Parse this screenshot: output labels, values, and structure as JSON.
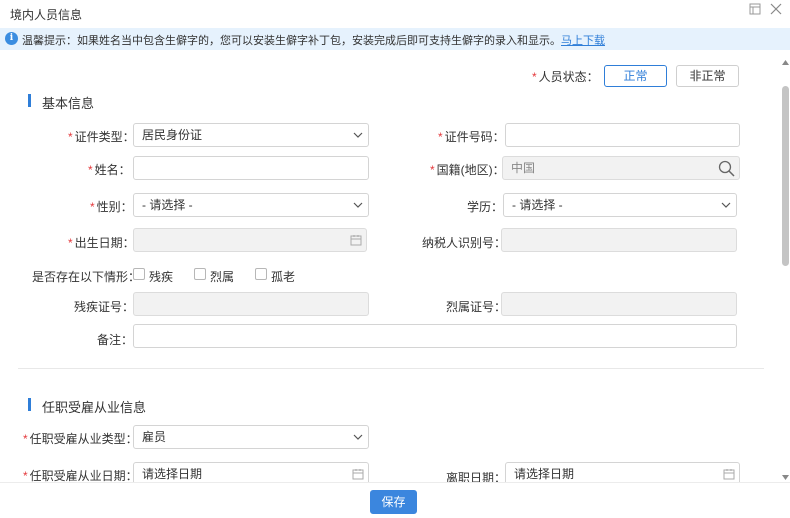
{
  "window": {
    "title": "境内人员信息",
    "maximize_icon": "maximize-icon",
    "close_icon": "close-icon"
  },
  "notice": {
    "text": "温馨提示：如果姓名当中包含生僻字的，您可以安装生僻字补丁包，安装完成后即可支持生僻字的录入和显示。",
    "link_text": "马上下载"
  },
  "status": {
    "label": "人员状态：",
    "options": [
      "正常",
      "非正常"
    ],
    "selected": "正常"
  },
  "basic": {
    "title": "基本信息",
    "id_type": {
      "label": "证件类型：",
      "value": "居民身份证"
    },
    "id_number": {
      "label": "证件号码：",
      "value": ""
    },
    "name": {
      "label": "姓名：",
      "value": ""
    },
    "nationality": {
      "label": "国籍(地区)：",
      "value": "中国"
    },
    "gender": {
      "label": "性别：",
      "value": "- 请选择 -"
    },
    "education": {
      "label": "学历：",
      "value": "- 请选择 -"
    },
    "birthdate": {
      "label": "出生日期：",
      "value": ""
    },
    "taxpayer_id": {
      "label": "纳税人识别号：",
      "value": ""
    },
    "situations": {
      "label": "是否存在以下情形：",
      "options": [
        "残疾",
        "烈属",
        "孤老"
      ]
    },
    "disability_no": {
      "label": "残疾证号：",
      "value": ""
    },
    "martyr_no": {
      "label": "烈属证号：",
      "value": ""
    },
    "remarks": {
      "label": "备注：",
      "value": ""
    }
  },
  "employment": {
    "title": "任职受雇从业信息",
    "type": {
      "label": "任职受雇从业类型：",
      "value": "雇员"
    },
    "start_date": {
      "label": "任职受雇从业日期：",
      "placeholder": "请选择日期"
    },
    "leave_date": {
      "label": "离职日期：",
      "placeholder": "请选择日期"
    }
  },
  "footer": {
    "save_label": "保存"
  },
  "colors": {
    "accent": "#2f7ed8",
    "required": "#e4393c",
    "notice_bg": "#e6f2fd"
  }
}
